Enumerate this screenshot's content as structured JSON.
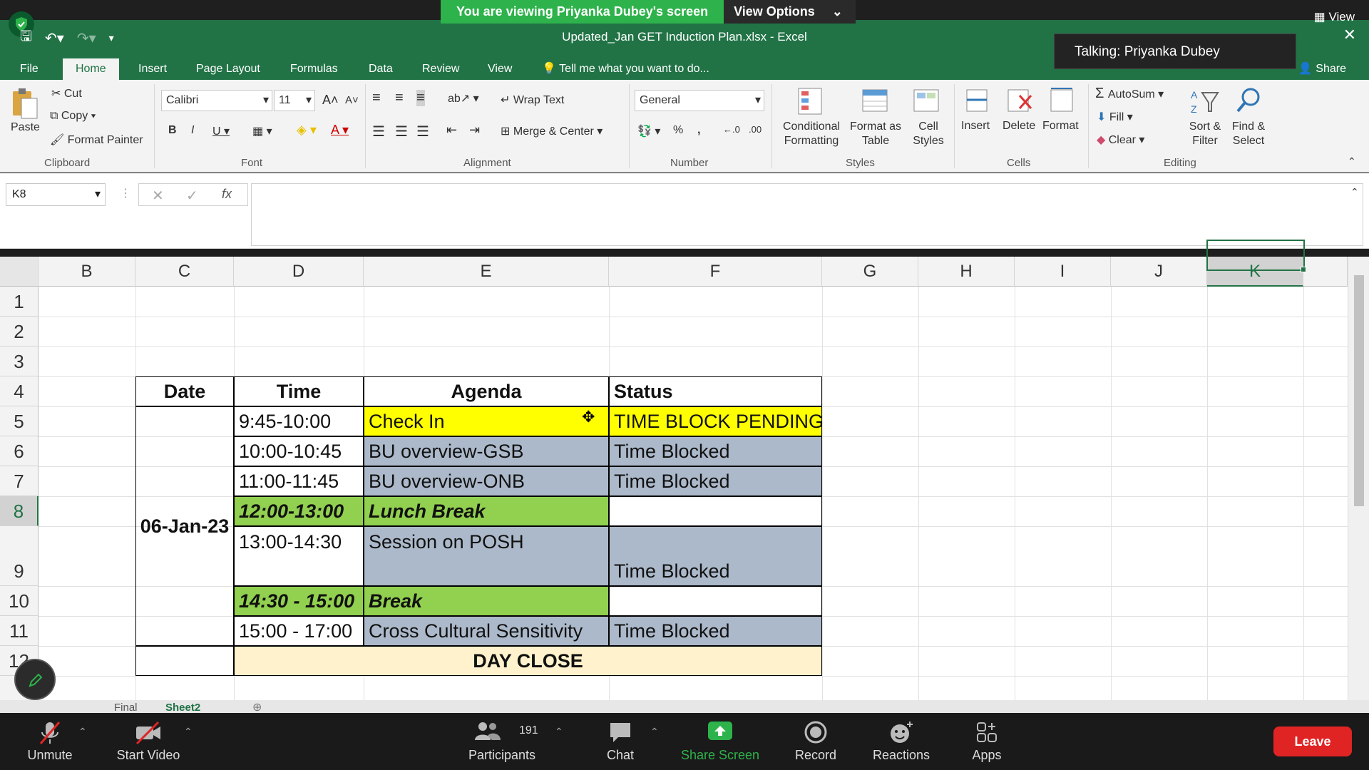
{
  "zoom": {
    "banner_text": "You are viewing Priyanka Dubey's screen",
    "view_options": "View Options",
    "view_label": "View",
    "talking": "Talking: Priyanka Dubey",
    "participants_count": "191",
    "toolbar": [
      {
        "id": "unmute",
        "label": "Unmute"
      },
      {
        "id": "start-video",
        "label": "Start Video"
      },
      {
        "id": "participants",
        "label": "Participants"
      },
      {
        "id": "chat",
        "label": "Chat"
      },
      {
        "id": "share-screen",
        "label": "Share Screen"
      },
      {
        "id": "record",
        "label": "Record"
      },
      {
        "id": "reactions",
        "label": "Reactions"
      },
      {
        "id": "apps",
        "label": "Apps"
      }
    ],
    "leave": "Leave"
  },
  "excel": {
    "doc_title": "Updated_Jan GET Induction Plan.xlsx  -  Excel",
    "tabs": [
      "File",
      "Home",
      "Insert",
      "Page Layout",
      "Formulas",
      "Data",
      "Review",
      "View"
    ],
    "tell_me": "Tell me what you want to do...",
    "share": "Share",
    "ribbon": {
      "paste": "Paste",
      "cut": "Cut",
      "copy": "Copy",
      "format_painter": "Format Painter",
      "clipboard": "Clipboard",
      "font_name": "Calibri",
      "font_size": "11",
      "font": "Font",
      "wrap_text": "Wrap Text",
      "merge_center": "Merge & Center",
      "alignment": "Alignment",
      "number_format": "General",
      "number": "Number",
      "conditional_formatting": "Conditional Formatting",
      "format_as_table": "Format as Table",
      "cell_styles": "Cell Styles",
      "styles": "Styles",
      "insert": "Insert",
      "delete": "Delete",
      "format": "Format",
      "cells": "Cells",
      "autosum": "AutoSum",
      "fill": "Fill",
      "clear": "Clear",
      "sort_filter": "Sort & Filter",
      "find_select": "Find & Select",
      "editing": "Editing"
    },
    "namebox": "K8",
    "columns": [
      "B",
      "C",
      "D",
      "E",
      "F",
      "G",
      "H",
      "I",
      "J",
      "K"
    ],
    "rows": [
      "1",
      "2",
      "3",
      "4",
      "5",
      "6",
      "7",
      "8",
      "9",
      "10",
      "11",
      "12"
    ],
    "headers": {
      "date": "Date",
      "time": "Time",
      "agenda": "Agenda",
      "status": "Status"
    },
    "date": "06-Jan-23",
    "schedule": [
      {
        "time": "9:45-10:00",
        "agenda": "Check In",
        "status": "TIME BLOCK PENDING"
      },
      {
        "time": "10:00-10:45",
        "agenda": "BU overview-GSB",
        "status": "Time Blocked"
      },
      {
        "time": "11:00-11:45",
        "agenda": "BU overview-ONB",
        "status": "Time Blocked"
      },
      {
        "time": "12:00-13:00",
        "agenda": "Lunch Break",
        "status": ""
      },
      {
        "time": "13:00-14:30",
        "agenda": "Session on POSH",
        "status": "Time Blocked"
      },
      {
        "time": "14:30 - 15:00",
        "agenda": "Break",
        "status": ""
      },
      {
        "time": "15:00 - 17:00",
        "agenda": "Cross Cultural Sensitivity",
        "status": "Time Blocked"
      }
    ],
    "day_close": "DAY CLOSE",
    "sheet_tabs": [
      "Final",
      "Sheet2"
    ],
    "colors": {
      "excel_green": "#217346",
      "yellow": "#ffff00",
      "blue_grey": "#acb9ca",
      "lime": "#92d050",
      "cream": "#fff2cc"
    }
  }
}
